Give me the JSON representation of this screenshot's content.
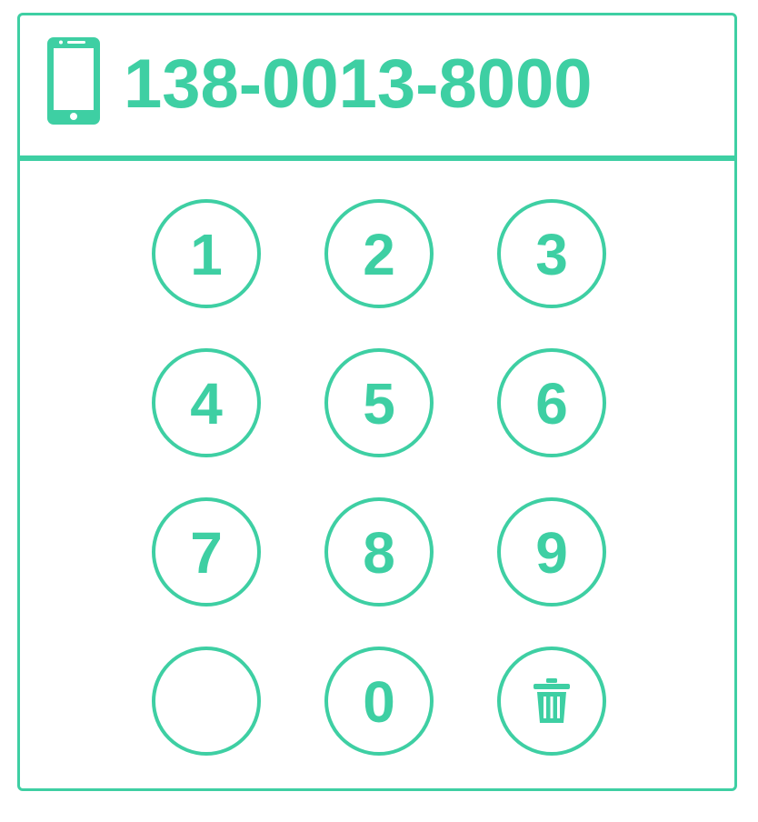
{
  "display": {
    "phone_number": "138-0013-8000",
    "icon": "smartphone-icon"
  },
  "keypad": {
    "keys": [
      {
        "label": "1"
      },
      {
        "label": "2"
      },
      {
        "label": "3"
      },
      {
        "label": "4"
      },
      {
        "label": "5"
      },
      {
        "label": "6"
      },
      {
        "label": "7"
      },
      {
        "label": "8"
      },
      {
        "label": "9"
      },
      {
        "label": ""
      },
      {
        "label": "0"
      },
      {
        "label": "",
        "icon": "trash-icon"
      }
    ]
  },
  "colors": {
    "accent": "#3ecfa3",
    "background": "#ffffff"
  }
}
